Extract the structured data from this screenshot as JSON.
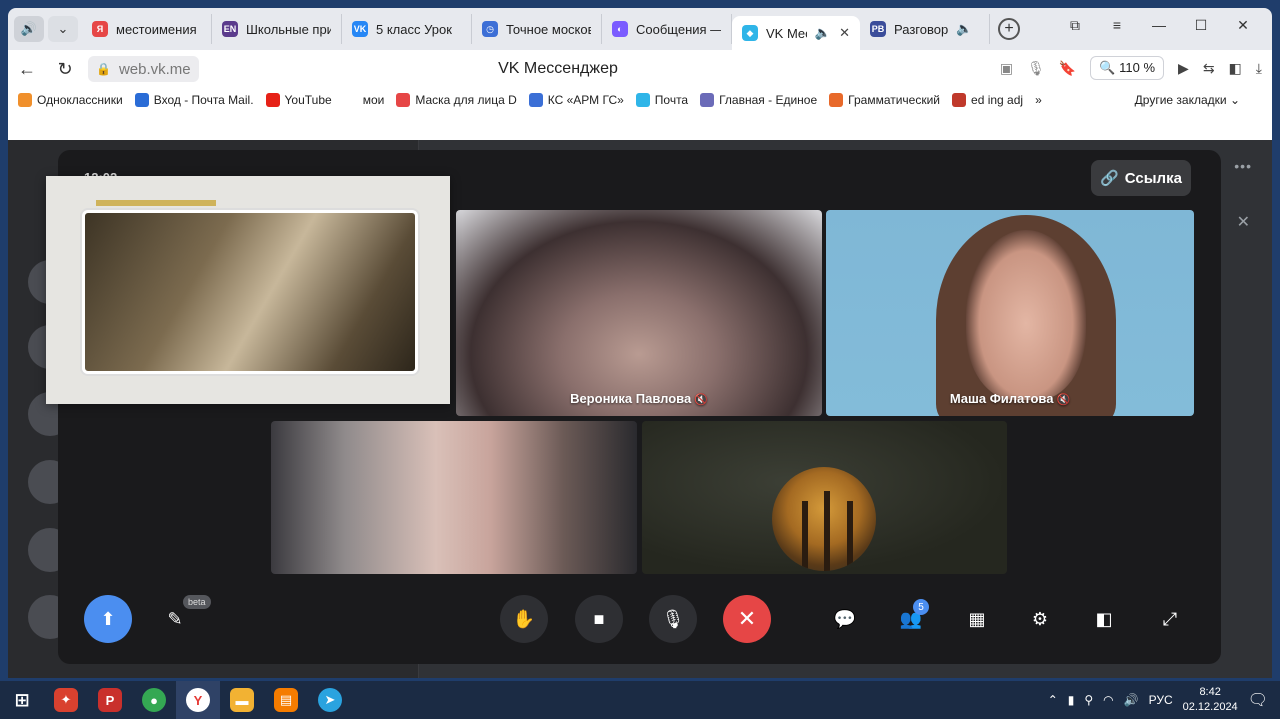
{
  "browser": {
    "tabs": [
      {
        "label": "местоимения в",
        "fav_color": "#e64646",
        "fav_text": "Я"
      },
      {
        "label": "Школьные при",
        "fav_color": "#5b3b8c",
        "fav_text": "EN"
      },
      {
        "label": "5 класс Урок",
        "fav_color": "#2787f5",
        "fav_text": "VK"
      },
      {
        "label": "Точное москов",
        "fav_color": "#3d6fd6",
        "fav_text": "◷"
      },
      {
        "label": "Сообщения — С",
        "fav_color": "#7b5cff",
        "fav_text": "◐"
      },
      {
        "label": "VK Мессе",
        "fav_color": "#2fb5e8",
        "fav_text": "◆",
        "active": true
      },
      {
        "label": "Разговор",
        "fav_color": "#3b4d9a",
        "fav_text": "PB"
      }
    ],
    "address": "web.vk.me",
    "page_title": "VK Мессенджер",
    "zoom": "110 %",
    "bookmarks": [
      {
        "label": "Одноклассники",
        "color": "#f0902c"
      },
      {
        "label": "Вход - Почта Mail.",
        "color": "#2a6cd6"
      },
      {
        "label": "YouTube",
        "color": "#e62117"
      },
      {
        "label": "мои",
        "color": "transparent"
      },
      {
        "label": "Маска для лица D",
        "color": "#e64646"
      },
      {
        "label": "КС «АРМ ГС»",
        "color": "#3b6fd6"
      },
      {
        "label": "Почта",
        "color": "#2fb5e8"
      },
      {
        "label": "Главная - Единое",
        "color": "#6b6bb8"
      },
      {
        "label": "Грамматический",
        "color": "#e8692a"
      },
      {
        "label": "ed ing adj",
        "color": "#c0392b"
      }
    ],
    "bookmarks_more": "»",
    "bookmarks_other": "Другие закладки"
  },
  "call": {
    "time": "12:02",
    "link_label": "Ссылка",
    "participants": [
      {
        "name": "Вероника Павлова"
      },
      {
        "name": "Маша Филатова"
      }
    ],
    "participants_count": "5",
    "beta_label": "beta"
  },
  "taskbar": {
    "lang": "РУС",
    "time": "8:42",
    "date": "02.12.2024"
  }
}
